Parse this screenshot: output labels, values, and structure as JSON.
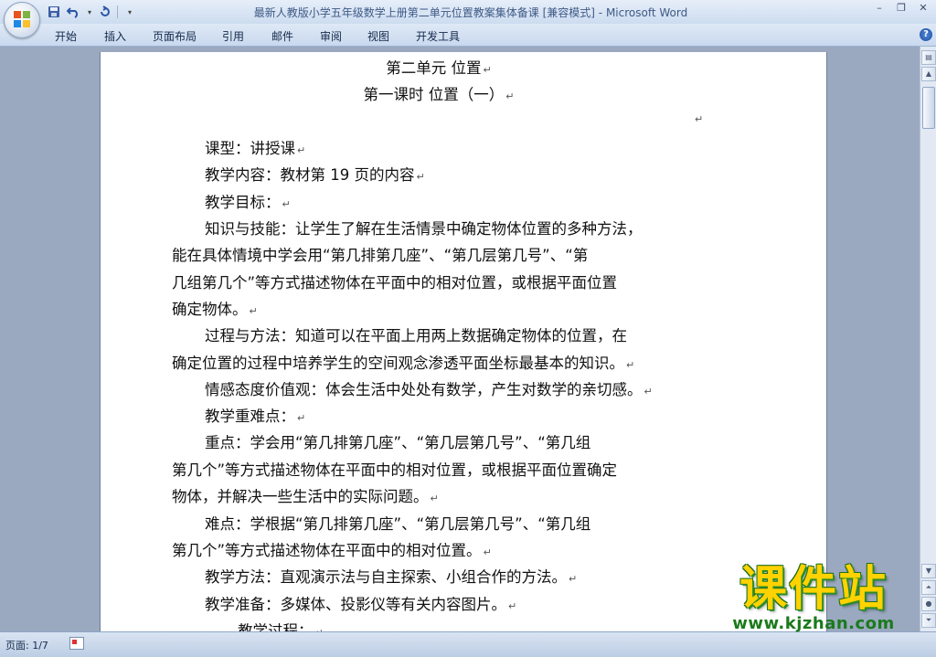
{
  "window": {
    "title": "最新人教版小学五年级数学上册第二单元位置教案集体备课 [兼容模式]",
    "separator": " - ",
    "app_name": "Microsoft Word"
  },
  "ribbon": {
    "tabs": [
      "开始",
      "插入",
      "页面布局",
      "引用",
      "邮件",
      "审阅",
      "视图",
      "开发工具"
    ]
  },
  "document": {
    "paragraph_mark": "↵",
    "lines": [
      "第二单元 位置",
      "第一课时    位置（一）",
      "",
      "课型：讲授课",
      "教学内容：教材第 19 页的内容",
      "教学目标：",
      "知识与技能：让学生了解在生活情景中确定物体位置的多种方法，",
      "能在具体情境中学会用“第几排第几座”、“第几层第几号”、“第",
      "几组第几个”等方式描述物体在平面中的相对位置，或根据平面位置",
      "确定物体。",
      "过程与方法：知道可以在平面上用两上数据确定物体的位置，在",
      "确定位置的过程中培养学生的空间观念渗透平面坐标最基本的知识。",
      "情感态度价值观：体会生活中处处有数学，产生对数学的亲切感。",
      "教学重难点：",
      "重点：学会用“第几排第几座”、“第几层第几号”、“第几组",
      "第几个”等方式描述物体在平面中的相对位置，或根据平面位置确定",
      "物体，并解决一些生活中的实际问题。",
      "难点：学根据“第几排第几座”、“第几层第几号”、“第几组",
      "第几个”等方式描述物体在平面中的相对位置。",
      "教学方法：直观演示法与自主探索、小组合作的方法。",
      "教学准备：多媒体、投影仪等有关内容图片。",
      "教学过程："
    ]
  },
  "status_bar": {
    "page_info": "页面: 1/7"
  },
  "watermark": {
    "title": "课件站",
    "url": "www.kjzhan.com"
  },
  "colors": {
    "title_text": "#3e5a86",
    "watermark_fill": "#ffd200",
    "watermark_outline": "#1e6e1e"
  }
}
